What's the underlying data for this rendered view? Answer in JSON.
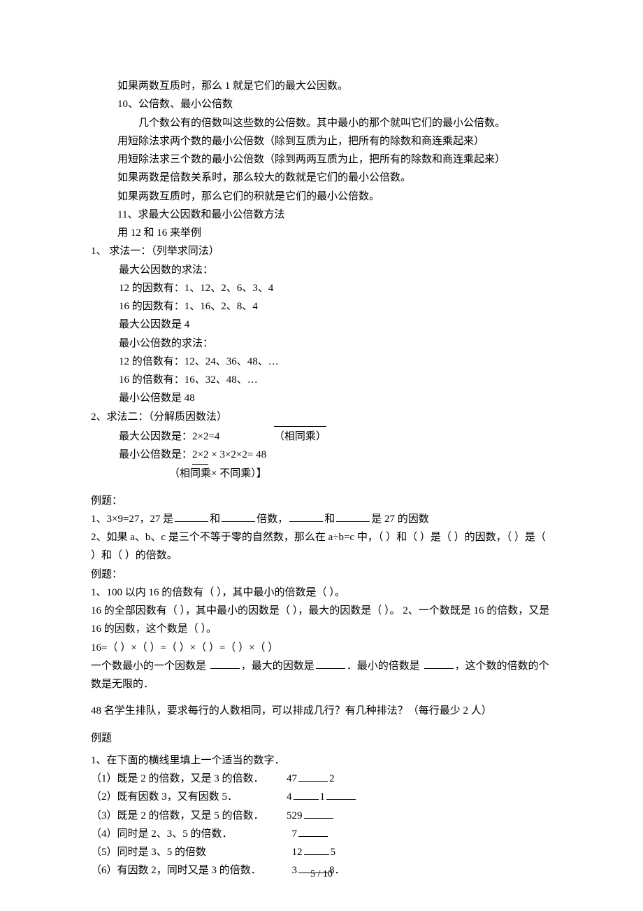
{
  "c1": "如果两数互质时，那么 1 就是它们的最大公因数。",
  "c2": "10、公倍数、最小公倍数",
  "c3": "几个数公有的倍数叫这些数的公倍数。其中最小的那个就叫它们的最小公倍数。",
  "c4": "用短除法求两个数的最小公倍数（除到互质为止，把所有的除数和商连乘起来）",
  "c5": "用短除法求三个数的最小公倍数（除到两两互质为止，把所有的除数和商连乘起来）",
  "c6": "如果两数是倍数关系时，那么较大的数就是它们的最小公倍数。",
  "c7": "如果两数互质时，那么它们的积就是它们的最小公倍数。",
  "c8": "11、求最大公因数和最小公倍数方法",
  "c9": "用 12 和 16 来举例",
  "m1": "1、  求法一：（列举求同法）",
  "m2": "最大公因数的求法：",
  "m3": "12 的因数有：1、12、2、6、3、4",
  "m4": "16 的因数有：1、16、2、8、4",
  "m5": "最大公因数是 4",
  "m6": "最小公倍数的求法：",
  "m7": "12 的倍数有：12、24、36、48、…",
  "m8": "16 的倍数有：16、32、48、…",
  "m9": "最小公倍数是 48",
  "n1": "2、求法二：（分解质因数法）",
  "n2a": "最大公因数是：2×2=4",
  "n2b": "（相同乘）",
  "n3a": "最小公倍数是：",
  "n3b": "2×2",
  "n3c": "  × 3×2×2= 48",
  "n4": "（相同乘× 不同乘）】",
  "ex1": "例题：",
  "ex2a": "1、3×9=27，27 是",
  "ex2b": "和",
  "ex2c": "倍数，",
  "ex2d": "和",
  "ex2e": "是 27 的因数",
  "ex3": "2、如果 a、b、c 是三个不等于零的自然数，那么在 a÷b=c 中，（  ）和（  ）是（  ）的因数，（  ）是（ ）和（  ）的倍数。",
  "ex4": "例题：",
  "ex5": "1、100 以内 16 的倍数有（                                 ），其中最小的倍数是（     ）。",
  "ex6": "  16 的全部因数有（                                       ），其中最小的因数是（  ），最大的因数是（  ）。  2、一个数既是 16 的倍数，又是 16 的因数，这个数是（    ）。",
  "ex7": "16=（   ）×（   ）=（   ）×（   ）=（   ）×（   ）",
  "ex8a": "一个数最小的一个因数是 ",
  "ex8b": "，最大的因数是",
  "ex8c": "．最小的倍数是 ",
  "ex8d": "，这个数的倍数的个数是无限的．",
  "ex9": "48 名学生排队，要求每行的人数相同，可以排成几行？有几种排法？（每行最少 2 人）",
  "ex10": "例题",
  "ex11": "1、在下面的横线里填上一个适当的数字．",
  "f1a": "（1）既是 2 的倍数，又是 3 的倍数．",
  "f1b": "47",
  "f1c": "2",
  "f2a": "（2）既有因数 3，又有因数 5．",
  "f2b": "4",
  "f2c": "1",
  "f3a": "（3）既是 2 的倍数，又是 5 的倍数．",
  "f3b": "529",
  "f4a": "（4）同时是 2、3、5 的倍数．",
  "f4b": "7",
  "f5a": "（5）同时是 3、5 的倍数",
  "f5b": "12",
  "f5c": "5",
  "f6a": "（6）有因数 2，同时又是 3 的倍数．",
  "f6b": "3",
  "f6c": "8．",
  "footer": "5 / 10"
}
